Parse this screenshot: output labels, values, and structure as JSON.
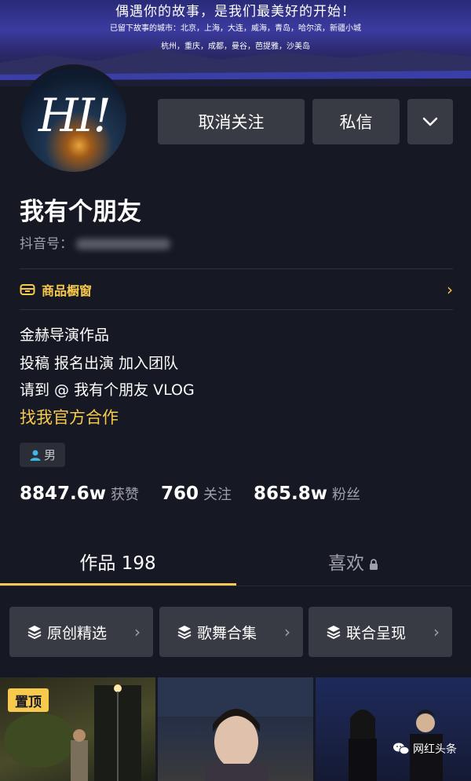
{
  "banner": {
    "headline": "偶遇你的故事，是我们最美好的开始！",
    "cities_line1": "已留下故事的城市：北京，上海，大连，威海，青岛，哈尔滨，新疆小城",
    "cities_line2": "杭州，重庆，成都，曼谷，芭提雅，沙美岛"
  },
  "avatar": {
    "text": "HI!"
  },
  "actions": {
    "unfollow_label": "取消关注",
    "message_label": "私信",
    "more_icon": "chevron-down-icon"
  },
  "profile": {
    "name": "我有个朋友",
    "douyin_id_label": "抖音号："
  },
  "shop": {
    "label": "商品橱窗",
    "icon": "shop-icon"
  },
  "bio": {
    "line1": "金赫导演作品",
    "line2": "投稿 报名出演 加入团队",
    "line3": "请到 @ 我有个朋友 VLOG",
    "cooperation_link": "找我官方合作"
  },
  "gender": {
    "label": "男",
    "icon": "person-icon"
  },
  "stats": {
    "likes_value": "8847.6w",
    "likes_label": "获赞",
    "following_value": "760",
    "following_label": "关注",
    "followers_value": "865.8w",
    "followers_label": "粉丝"
  },
  "tabs": {
    "works_label": "作品 198",
    "likes_label": "喜欢"
  },
  "collections": [
    {
      "label": "原创精选"
    },
    {
      "label": "歌舞合集"
    },
    {
      "label": "联合呈现"
    }
  ],
  "videos": {
    "pinned_label": "置顶"
  },
  "watermark": {
    "label": "网红头条"
  },
  "colors": {
    "background": "#161823",
    "accent": "#f7c94d",
    "button": "#393b44"
  }
}
